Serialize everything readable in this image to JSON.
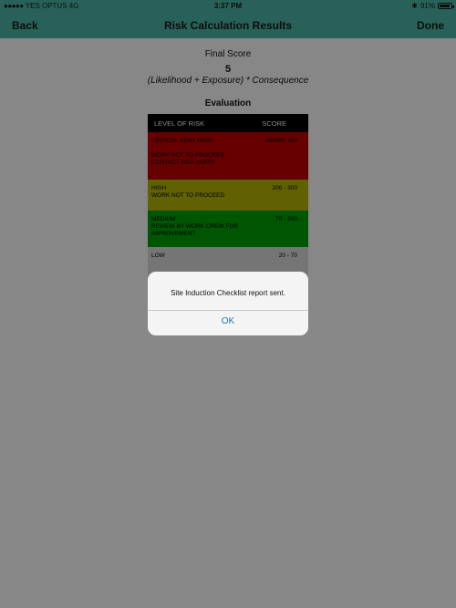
{
  "status_bar": {
    "signal_dots": "●●●●●",
    "carrier": "YES OPTUS",
    "network": "4G",
    "time": "3:37 PM",
    "bluetooth": "✱",
    "battery_percent": "91%",
    "battery_level": 0.91
  },
  "nav": {
    "back_label": "Back",
    "title": "Risk Calculation Results",
    "done_label": "Done"
  },
  "results": {
    "final_label": "Final Score",
    "final_score": "5",
    "formula": "(Likelihood + Exposure) * Consequence",
    "evaluation_heading": "Evaluation"
  },
  "risk_table": {
    "headers": [
      "LEVEL OF RISK",
      "SCORE"
    ],
    "rows": [
      {
        "level_line1": "CRITICAL VERY HIGH",
        "level_line2": "WORK NOT TO PROCEED",
        "level_line3": "CONTACT REG VARTY",
        "score": "ABOVE 300",
        "color": "#c00000"
      },
      {
        "level_line1": "HIGH",
        "level_line2": "WORK NOT TO PROCEED",
        "level_line3": "",
        "score": "200 - 300",
        "color": "#b5b800"
      },
      {
        "level_line1": "MEDIUM",
        "level_line2": "REVIEW BY WORK CREW FOR",
        "level_line3": "IMPROVEMENT",
        "score": "70 - 200",
        "color": "#00a000"
      },
      {
        "level_line1": "LOW",
        "level_line2": "",
        "level_line3": "",
        "score": "20 - 70",
        "color": "#dddddd"
      }
    ]
  },
  "alert": {
    "message": "Site Induction Checklist report sent.",
    "ok_label": "OK"
  },
  "colors": {
    "nav_bar": "#4db8a8",
    "alert_button": "#1a73c9"
  }
}
